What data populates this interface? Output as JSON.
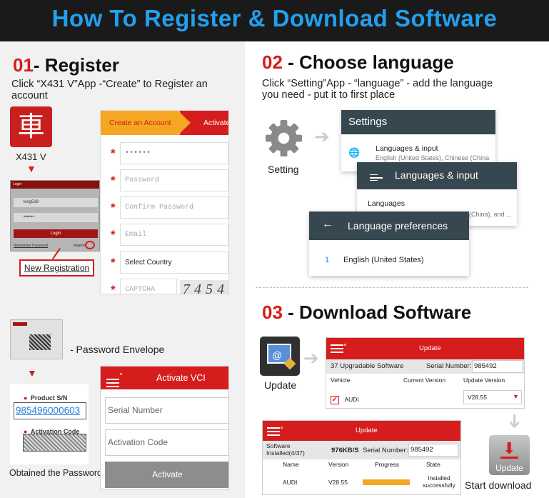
{
  "banner": {
    "title": "How To Register & Download Software"
  },
  "step1": {
    "num": "01",
    "title": "- Register",
    "desc_line1": "Click “X431 V”App -“Create” to Register an",
    "desc_line2": "account",
    "app_label": "X431 V",
    "app_glyph": "車",
    "login": {
      "title": "Login",
      "username": "king518",
      "password": "•••••••",
      "button": "Login",
      "remember": "Remember Password",
      "register_short": "Register"
    },
    "new_registration": "New Registration",
    "form": {
      "tab_create": "Create an Account",
      "tab_activate": "Activate",
      "username_value": "••••••",
      "password_ph": "Password",
      "confirm_ph": "Confirm Password",
      "email_ph": "Email",
      "country": "Select Country",
      "captcha_ph": "CAPTCHA",
      "captcha_code": "7454"
    },
    "envelope_label": "- Password Envelope",
    "product_sn_label": "Product S/N",
    "product_sn_value": "985496000603",
    "activation_code_label": "Activation Code",
    "obtained_label": "Obtained the Password",
    "vci": {
      "title": "Activate VCI",
      "serial_ph": "Serial Number",
      "activation_ph": "Activation Code",
      "button": "Activate"
    }
  },
  "step2": {
    "num": "02",
    "title": " - Choose language",
    "desc_line1": "Click “Setting”App - “language” - add the language",
    "desc_line2": "you need - put it to first place",
    "setting_label": "Setting",
    "settings_title": "Settings",
    "lang_input_title": "Languages & input",
    "lang_input_sub": "English (United States), Chinese (China",
    "languages_title": "Languages & input",
    "languages_item": "Languages",
    "languages_sub": "(China), and ...",
    "pref_title": "Language preferences",
    "pref_index": "1",
    "pref_lang": "English (United States)"
  },
  "step3": {
    "num": "03",
    "title": " - Download Software",
    "update_label": "Update",
    "start_download": "Start download",
    "table1": {
      "title": "Update",
      "count": "37 Upgradable Software",
      "sn_label": "Serial Number:",
      "sn_value": "985492",
      "col_vehicle": "Vehicle",
      "col_current": "Current Version",
      "col_update": "Update Version",
      "row_vehicle": "AUDI",
      "row_update": "V28.55"
    },
    "table2": {
      "title": "Update",
      "installed_line1": "Software",
      "installed_line2": "Installed(4/37)",
      "speed": "976KB/S",
      "sn_label": "Serial Number:",
      "sn_value": "985492",
      "col_name": "Name",
      "col_version": "Version",
      "col_progress": "Progress",
      "col_state": "State",
      "row_name": "AUDI",
      "row_version": "V28.55",
      "row_progress": 1.0,
      "row_state_line1": "Installed",
      "row_state_line2": "successfully"
    },
    "dl_button": "Update"
  },
  "colors": {
    "accent_red": "#d61d1d",
    "banner_blue": "#22a0ee",
    "orange": "#f5a623",
    "settings_dark": "#37474f"
  }
}
